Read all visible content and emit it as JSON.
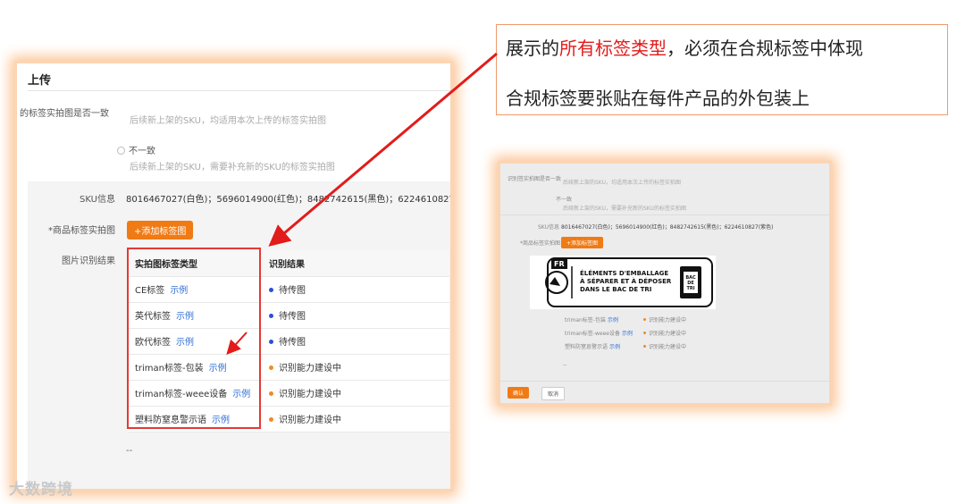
{
  "callout": {
    "line1_prefix": "展示的",
    "line1_highlight": "所有标签类型",
    "line1_suffix": "，必须在合规标签中体现",
    "line2": "合规标签要张贴在每件产品的外包装上"
  },
  "left_screenshot": {
    "title": "上传",
    "consistent_question": "的标签实拍图是否一致",
    "option_consistent_hint": "后续新上架的SKU，均适用本次上传的标签实拍图",
    "option_inconsistent_label": "不一致",
    "option_inconsistent_hint": "后续新上架的SKU，需要补充新的SKU的标签实拍图",
    "sku_label": "SKU信息",
    "sku_value": "8016467027(白色)；5696014900(红色)；8482742615(黑色)；6224610827(紫色)",
    "photo_label": "*商品标签实拍图",
    "add_button": "+添加标签图",
    "recognition_label": "图片识别结果",
    "table": {
      "headers": [
        "实拍图标签类型",
        "识别结果"
      ],
      "rows": [
        {
          "type": "CE标签",
          "link": "示例",
          "status": "待传图",
          "status_color": "blue"
        },
        {
          "type": "英代标签",
          "link": "示例",
          "status": "待传图",
          "status_color": "blue"
        },
        {
          "type": "欧代标签",
          "link": "示例",
          "status": "待传图",
          "status_color": "blue"
        },
        {
          "type": "triman标签-包装",
          "link": "示例",
          "status": "识别能力建设中",
          "status_color": "orange"
        },
        {
          "type": "triman标签-weee设备",
          "link": "示例",
          "status": "识别能力建设中",
          "status_color": "orange"
        },
        {
          "type": "塑料防窒息警示语",
          "link": "示例",
          "status": "识别能力建设中",
          "status_color": "orange"
        }
      ]
    },
    "dash": "--"
  },
  "right_screenshot": {
    "question": "识别签实拍图是否一致",
    "hint1": "后续新上架的SKU，均适用本次上传的标签实拍图",
    "option_inconsistent": "不一致",
    "hint2": "后续新上架的SKU，需要补充新的SKU的标签实拍图",
    "sku_label": "SKU信息",
    "sku_value": "8016467027(白色)；5696014900(红色)；8482742615(黑色)；6224610827(紫色)",
    "photo_label": "*商品标签实拍图",
    "add_button": "+添加标签图",
    "badge": {
      "tag": "FR",
      "line1": "ÉLÉMENTS D'EMBALLAGE",
      "line2": "À SÉPARER ET À DÉPOSER",
      "line3": "DANS LE BAC DE TRI",
      "bin_text": "BAC DE TRI"
    },
    "rows": [
      {
        "type": "triman标签-包装",
        "link": "示例",
        "status": "识别能力建设中"
      },
      {
        "type": "triman标签-weee设备",
        "link": "示例",
        "status": "识别能力建设中"
      },
      {
        "type": "塑料防窒息警示语",
        "link": "示例",
        "status": "识别能力建设中"
      }
    ],
    "dash": "--",
    "confirm": "确认",
    "cancel": "取消"
  },
  "watermark": "大数跨境",
  "colors": {
    "accent_orange": "#f07a14",
    "highlight_red": "#e21b1b",
    "link_blue": "#2f6fd6",
    "glow": "#fcc596"
  }
}
